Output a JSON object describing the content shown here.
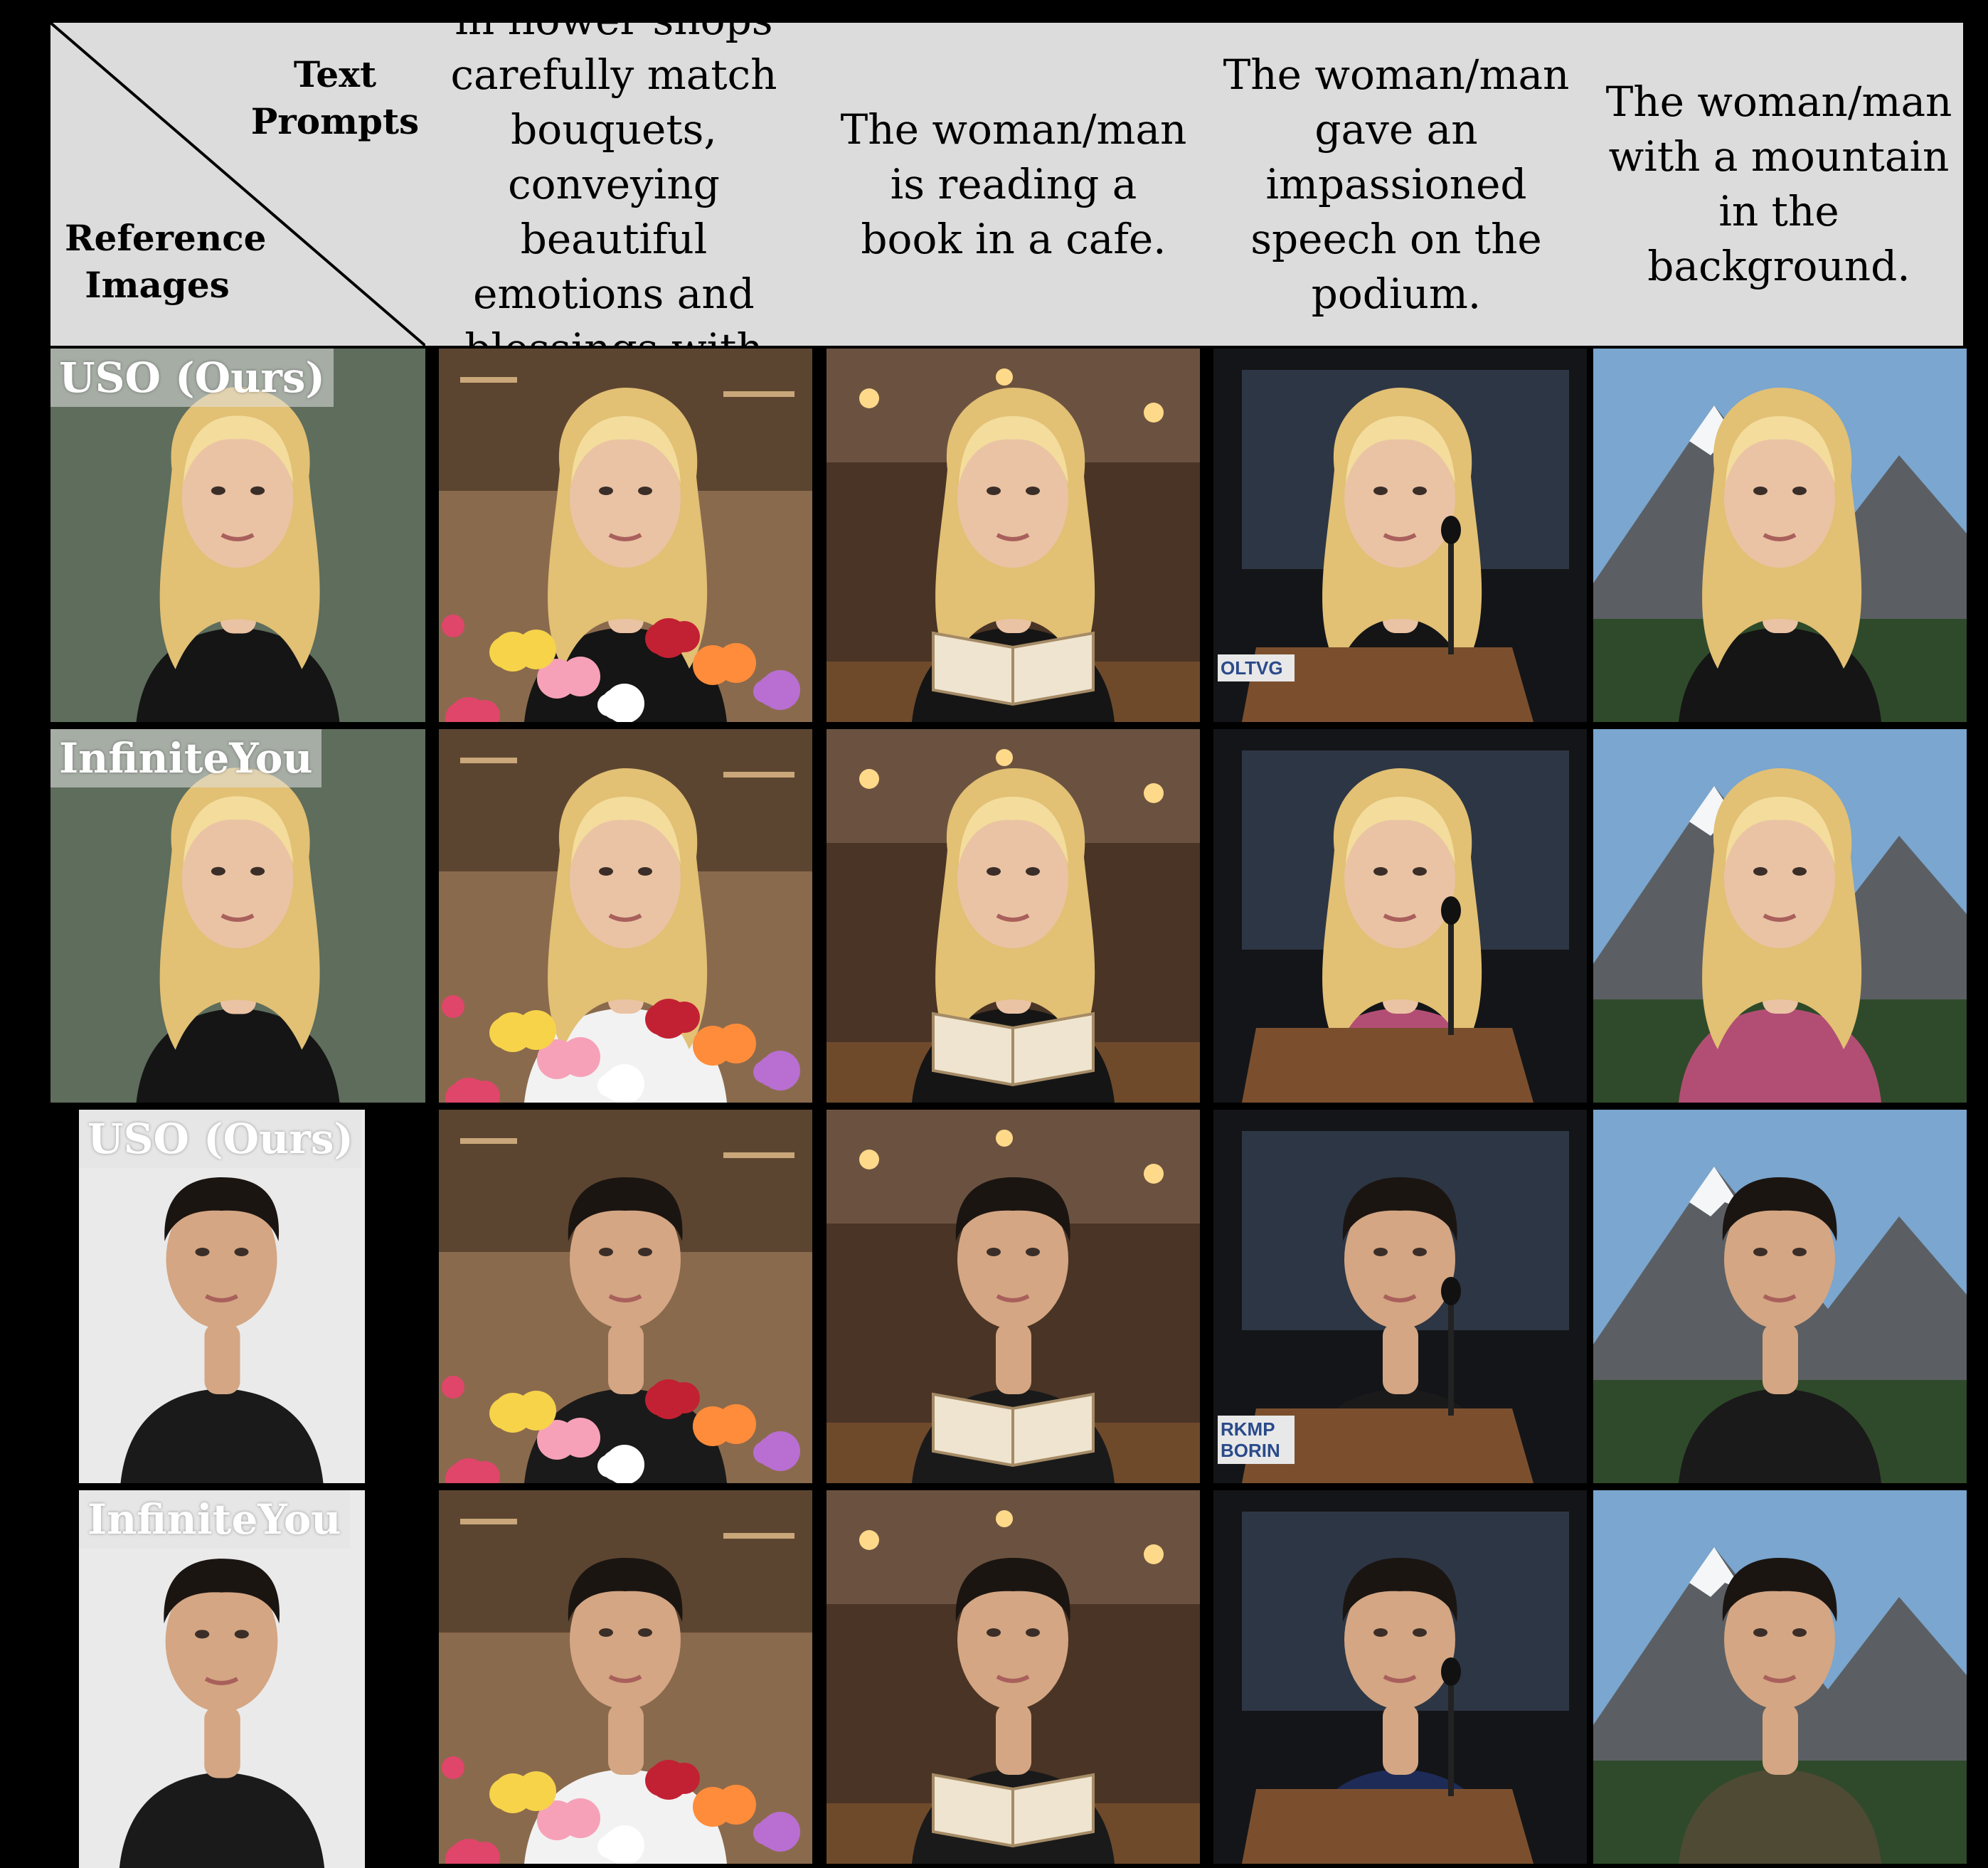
{
  "header": {
    "corner_top_label": "Text\nPrompts",
    "corner_bottom_label": "Reference\nImages",
    "prompts": [
      "The woman/man in flower shops carefully match bouquets, conveying beautiful emotions and blessings with flowers.",
      "The woman/man is reading a book in a cafe.",
      "The woman/man gave an impassioned speech on the podium.",
      "The woman/man with a mountain in the background."
    ]
  },
  "rows": [
    {
      "method": "USO (Ours)",
      "subject": "blonde-woman"
    },
    {
      "method": "InfiniteYou",
      "subject": "blonde-woman"
    },
    {
      "method": "USO (Ours)",
      "subject": "dark-haired-man"
    },
    {
      "method": "InfiniteYou",
      "subject": "dark-haired-man"
    }
  ],
  "scenes": [
    "flower-shop",
    "cafe-reading",
    "podium-speech",
    "mountain-background"
  ],
  "podium_sign_text": [
    "OLTVG",
    "",
    "RKMP BORIN",
    ""
  ],
  "colors": {
    "background": "#000000",
    "header_band": "#dcdcdc",
    "badge_text": "#ffffff"
  }
}
